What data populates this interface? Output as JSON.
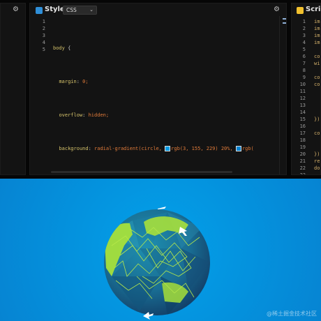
{
  "left_panel": {
    "gear_icon": "gear-icon"
  },
  "style_panel": {
    "title": "Style",
    "badge_color": "#2f8fd8",
    "language_select": "CSS",
    "line_numbers": [
      "1",
      "2",
      "3",
      "4",
      "5"
    ],
    "code": {
      "line1_sel": "body",
      "line1_brace": " {",
      "line2_prop": "margin",
      "line2_val": " 0;",
      "line3_prop": "overflow",
      "line3_val": " hidden;",
      "line4_prop": "background",
      "line4_val_a": " radial-gradient(circle, ",
      "line4_val_b": "rgb(3, 155, 229) 20%, ",
      "line4_val_c": "rgb(",
      "line5": "}"
    }
  },
  "script_panel": {
    "title": "Script",
    "badge_color": "#f2c12e",
    "line_numbers": [
      "1",
      "2",
      "3",
      "4",
      "5",
      "6",
      "7",
      "8",
      "9",
      "10",
      "11",
      "12",
      "13",
      "14",
      "15",
      "16",
      "17",
      "18",
      "19",
      "20",
      "21",
      "22",
      "23"
    ],
    "code_lines": [
      "im",
      "im",
      "im",
      "im",
      "",
      "co",
      "wi",
      "",
      "co",
      "co",
      "",
      "",
      "",
      "",
      "});",
      "",
      "co",
      "",
      "",
      "})",
      "re",
      "do",
      ""
    ]
  },
  "stage": {
    "background": "#039be5",
    "watermark": "@稀土掘金技术社区"
  }
}
